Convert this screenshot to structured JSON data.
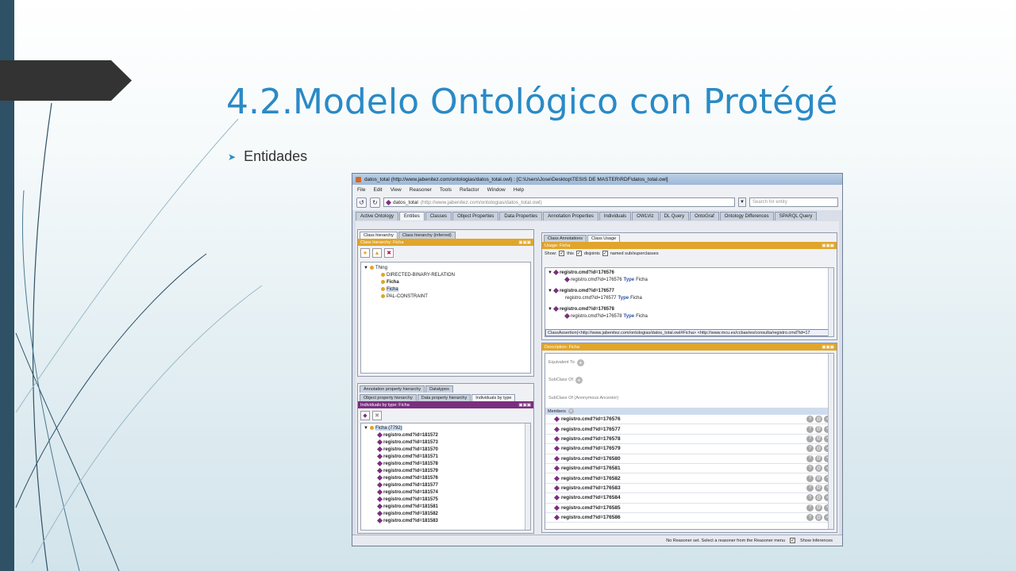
{
  "slide": {
    "title": "4.2.Modelo Ontológico con Protégé",
    "bullet": "Entidades"
  },
  "protege": {
    "window_title": "datos_total (http://www.jabenitez.com/ontologias/datos_total.owl) : [C:\\Users\\Jose\\Desktop\\TESIS DE MASTER\\RDF\\datos_total.owl]",
    "menu": [
      "File",
      "Edit",
      "View",
      "Reasoner",
      "Tools",
      "Refactor",
      "Window",
      "Help"
    ],
    "address": {
      "name": "datos_total",
      "url": "(http://www.jabenitez.com/ontologias/datos_total.owl)"
    },
    "search_placeholder": "Search for entity",
    "tabs": [
      "Active Ontology",
      "Entities",
      "Classes",
      "Object Properties",
      "Data Properties",
      "Annotation Properties",
      "Individuals",
      "OWLViz",
      "DL Query",
      "OntoGraf",
      "Ontology Differences",
      "SPARQL Query"
    ],
    "class_pane": {
      "subtabs": [
        "Class hierarchy",
        "Class hierarchy (inferred)"
      ],
      "header": "Class hierarchy: Ficha",
      "tree": [
        {
          "label": "Thing",
          "level": 0
        },
        {
          "label": "DIRECTED-BINARY-RELATION",
          "level": 1
        },
        {
          "label": "Ficha",
          "level": 1,
          "bold": true
        },
        {
          "label": "Ficha",
          "level": 1,
          "highlight": true
        },
        {
          "label": "PAL-CONSTRAINT",
          "level": 1
        }
      ]
    },
    "individuals_pane": {
      "subtabs_top": [
        "Annotation property hierarchy",
        "Datatypes"
      ],
      "subtabs": [
        "Object property hierarchy",
        "Data property hierarchy",
        "Individuals by type"
      ],
      "header": "Individuals by type: Ficha",
      "root": "Ficha (7792)",
      "items": [
        "registro.cmd?id=181572",
        "registro.cmd?id=181573",
        "registro.cmd?id=181570",
        "registro.cmd?id=181571",
        "registro.cmd?id=181578",
        "registro.cmd?id=181579",
        "registro.cmd?id=181576",
        "registro.cmd?id=181577",
        "registro.cmd?id=181574",
        "registro.cmd?id=181575",
        "registro.cmd?id=181581",
        "registro.cmd?id=181582",
        "registro.cmd?id=181583"
      ]
    },
    "usage_pane": {
      "subtabs": [
        "Class Annotations",
        "Class Usage"
      ],
      "header": "Usage: Ficha",
      "show_label": "Show:",
      "options": [
        "this",
        "disjoints",
        "named sub/superclasses"
      ],
      "items": [
        {
          "id": "registro.cmd?id=176576",
          "sub": "registro.cmd?id=176576",
          "type": "Type",
          "cls": "Ficha"
        },
        {
          "id": "registro.cmd?id=176577",
          "sub": "registro.cmd?id=176577",
          "type": "Type",
          "cls": "Ficha"
        },
        {
          "id": "registro.cmd?id=176578",
          "sub": "registro.cmd?id=176578",
          "type": "Type",
          "cls": "Ficha"
        }
      ],
      "tooltip": "ClassAssertion(<http://www.jabenitez.com/ontologias/datos_total.owl#Ficha> <http://www.mcu.es/ccbae/es/consulta/registro.cmd?id=17"
    },
    "description_pane": {
      "header": "Description: Ficha",
      "sections": [
        "Equivalent To",
        "SubClass Of",
        "SubClass Of (Anonymous Ancestor)"
      ],
      "members_label": "Members",
      "members": [
        "registro.cmd?id=176576",
        "registro.cmd?id=176577",
        "registro.cmd?id=176578",
        "registro.cmd?id=176579",
        "registro.cmd?id=176580",
        "registro.cmd?id=176581",
        "registro.cmd?id=176582",
        "registro.cmd?id=176583",
        "registro.cmd?id=176584",
        "registro.cmd?id=176585",
        "registro.cmd?id=176586"
      ]
    },
    "status": {
      "text": "No Reasoner set. Select a reasoner from the Reasoner menu",
      "show_inferences": "Show Inferences"
    }
  }
}
